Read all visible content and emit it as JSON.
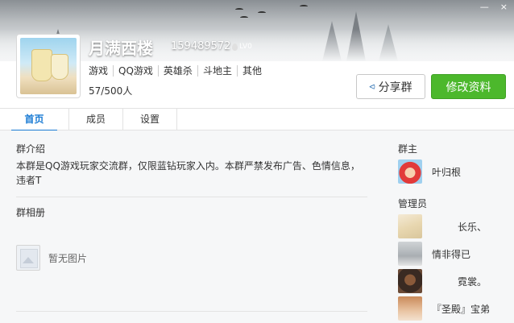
{
  "window": {
    "minimize_label": "—",
    "close_label": "×"
  },
  "group": {
    "name": "月满西楼",
    "id": "159489572",
    "level": "LV0",
    "tags": [
      "游戏",
      "QQ游戏",
      "英雄杀",
      "斗地主",
      "其他"
    ],
    "member_count": "57/500人"
  },
  "actions": {
    "share_label": "分享群",
    "edit_label": "修改资料"
  },
  "tabs": [
    {
      "label": "首页",
      "active": true
    },
    {
      "label": "成员",
      "active": false
    },
    {
      "label": "设置",
      "active": false
    }
  ],
  "intro": {
    "title": "群介绍",
    "text": "本群是QQ游戏玩家交流群，仅限蓝钻玩家入内。本群严禁发布广告、色情信息，违者T"
  },
  "album": {
    "title": "群相册",
    "empty_text": "暂无图片"
  },
  "owner": {
    "title": "群主",
    "name": "叶归根"
  },
  "admins": {
    "title": "管理员",
    "members": [
      {
        "name": "长乐、"
      },
      {
        "name": "情非得已"
      },
      {
        "name": "霓裳。"
      },
      {
        "name": "『圣殿』宝弟"
      }
    ]
  },
  "colors": {
    "accent": "#1a7bd4",
    "primary_button": "#4cb82c"
  }
}
